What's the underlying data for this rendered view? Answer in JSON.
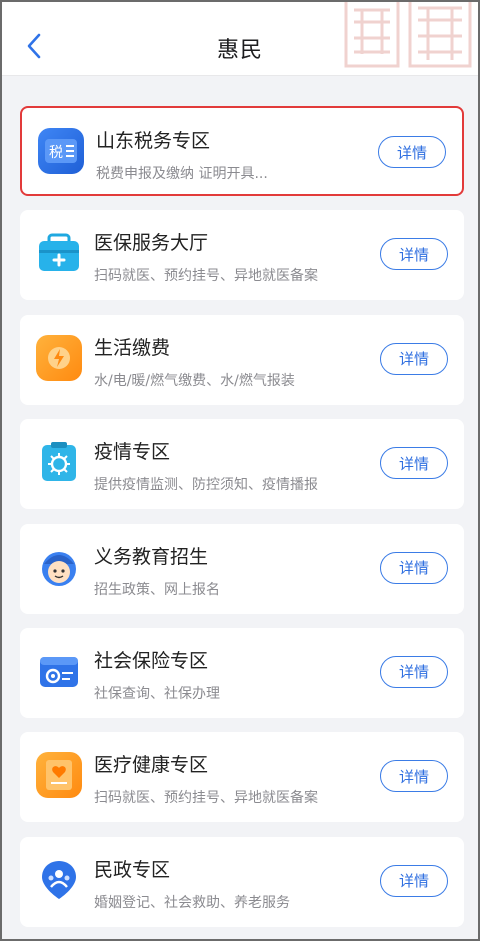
{
  "header": {
    "title": "惠民",
    "back_icon": "back-arrow-icon"
  },
  "services": [
    {
      "title": "山东税务专区",
      "subtitle": "税费申报及缴纳  证明开具...",
      "button": "详情",
      "icon": "tax-icon",
      "highlighted": true,
      "color": "#2f73e8"
    },
    {
      "title": "医保服务大厅",
      "subtitle": "扫码就医、预约挂号、异地就医备案",
      "button": "详情",
      "icon": "medical-kit-icon",
      "color": "#2bb3e8"
    },
    {
      "title": "生活缴费",
      "subtitle": "水/电/暖/燃气缴费、水/燃气报装",
      "button": "详情",
      "icon": "utility-bill-icon",
      "color": "#ffa21f"
    },
    {
      "title": "疫情专区",
      "subtitle": "提供疫情监测、防控须知、疫情播报",
      "button": "详情",
      "icon": "virus-icon",
      "color": "#31b7e8"
    },
    {
      "title": "义务教育招生",
      "subtitle": "招生政策、网上报名",
      "button": "详情",
      "icon": "student-icon",
      "color": "#3a7ff0"
    },
    {
      "title": "社会保险专区",
      "subtitle": "社保查询、社保办理",
      "button": "详情",
      "icon": "insurance-card-icon",
      "color": "#2f73e8"
    },
    {
      "title": "医疗健康专区",
      "subtitle": "扫码就医、预约挂号、异地就医备案",
      "button": "详情",
      "icon": "health-record-icon",
      "color": "#ffa21f"
    },
    {
      "title": "民政专区",
      "subtitle": "婚姻登记、社会救助、养老服务",
      "button": "详情",
      "icon": "civil-affairs-icon",
      "color": "#2f73e8"
    }
  ]
}
